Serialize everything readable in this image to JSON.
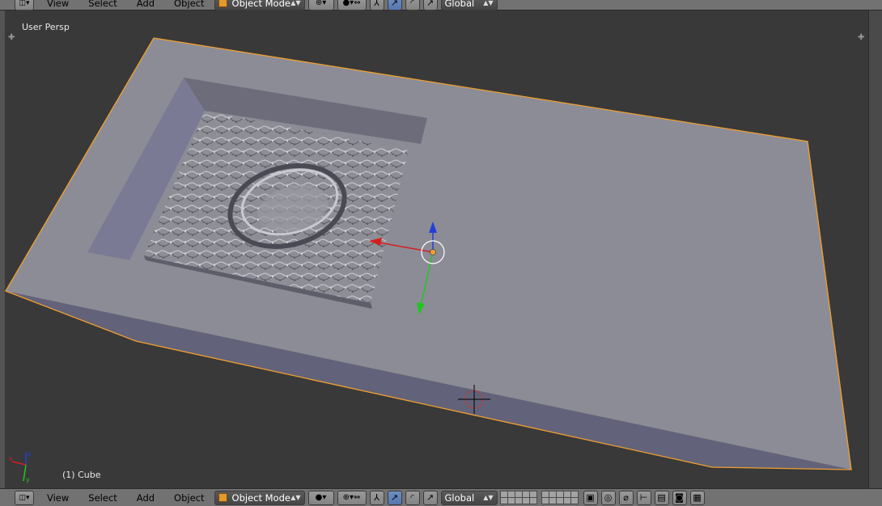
{
  "header_top": {
    "menus": [
      "View",
      "Select",
      "Add",
      "Object"
    ],
    "mode_label": "Object Mode",
    "orientation_label": "Global"
  },
  "viewport": {
    "view_label": "User Persp",
    "object_label": "(1) Cube"
  },
  "header_bottom": {
    "menus": [
      "View",
      "Select",
      "Add",
      "Object"
    ],
    "mode_label": "Object Mode",
    "orientation_label": "Global"
  },
  "colors": {
    "viewport_bg": "#393939",
    "mesh_top": "#8c8c96",
    "selection_outline": "#f0a030",
    "axis_x": "#d41f1f",
    "axis_y": "#24c424",
    "axis_z": "#2240d8"
  }
}
